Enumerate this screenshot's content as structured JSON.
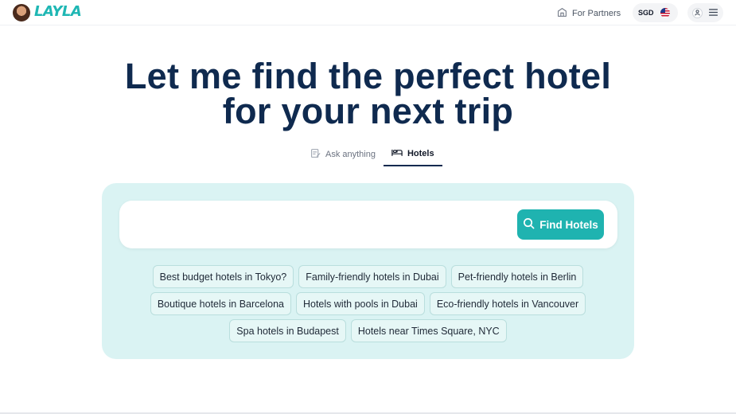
{
  "header": {
    "logo_text": "LAYLA",
    "partners_label": "For Partners",
    "currency": "SGD",
    "flag_icon": "us-flag-icon",
    "colors": {
      "brand": "#1fb7b4"
    }
  },
  "hero": {
    "title_line1": "Let me find the perfect hotel",
    "title_line2": "for your next trip"
  },
  "tabs": [
    {
      "label": "Ask anything",
      "icon": "edit-icon",
      "active": false
    },
    {
      "label": "Hotels",
      "icon": "bed-icon",
      "active": true
    }
  ],
  "search": {
    "value": "",
    "button_label": "Find Hotels",
    "colors": {
      "panel": "#daf3f3",
      "button": "#1fb3b0"
    }
  },
  "suggestions": [
    "Best budget hotels in Tokyo?",
    "Family-friendly hotels in Dubai",
    "Pet-friendly hotels in Berlin",
    "Boutique hotels in Barcelona",
    "Hotels with pools in Dubai",
    "Eco-friendly hotels in Vancouver",
    "Spa hotels in Budapest",
    "Hotels near Times Square, NYC"
  ]
}
